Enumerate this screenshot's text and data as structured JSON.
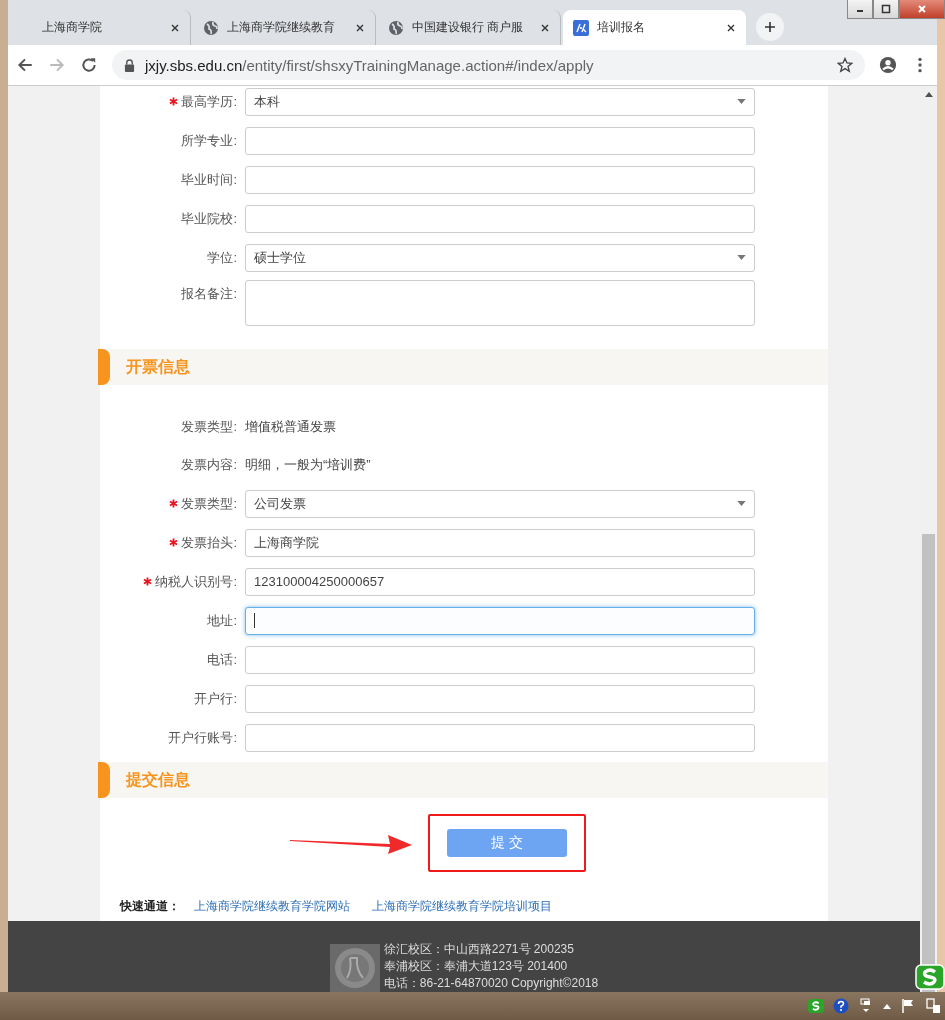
{
  "browser": {
    "tabs": [
      {
        "title": "上海商学院",
        "kind": "blank",
        "selected": false
      },
      {
        "title": "上海商学院继续教育",
        "kind": "web",
        "selected": false
      },
      {
        "title": "中国建设银行 商户服",
        "kind": "web",
        "selected": false
      },
      {
        "title": "培训报名",
        "kind": "site",
        "selected": true
      }
    ],
    "url_host": "jxjy.sbs.edu.cn",
    "url_path": "/entity/first/shsxyTrainingManage.action#/index/apply"
  },
  "education_rows": [
    {
      "kind": "select",
      "label": "最高学历:",
      "required": true,
      "value": "本科"
    },
    {
      "kind": "input",
      "label": "所学专业:",
      "required": false,
      "value": "",
      "focused": false
    },
    {
      "kind": "input",
      "label": "毕业时间:",
      "required": false,
      "value": "",
      "focused": false
    },
    {
      "kind": "input",
      "label": "毕业院校:",
      "required": false,
      "value": "",
      "focused": false
    },
    {
      "kind": "select",
      "label": "学位:",
      "required": false,
      "value": "硕士学位"
    },
    {
      "kind": "textarea",
      "label": "报名备注:",
      "required": false,
      "value": ""
    }
  ],
  "invoice_section": {
    "title": "开票信息"
  },
  "invoice_rows": [
    {
      "kind": "text",
      "label": "发票类型:",
      "value": "增值税普通发票"
    },
    {
      "kind": "text",
      "label": "发票内容:",
      "value": "明细，一般为“培训费”"
    },
    {
      "kind": "select",
      "label": "发票类型:",
      "required": true,
      "value": "公司发票"
    },
    {
      "kind": "input",
      "label": "发票抬头:",
      "required": true,
      "value": "上海商学院",
      "focused": false
    },
    {
      "kind": "input",
      "label": "纳税人识别号:",
      "required": true,
      "value": "123100004250000657",
      "focused": false
    },
    {
      "kind": "input",
      "label": "地址:",
      "required": false,
      "value": "",
      "focused": true
    },
    {
      "kind": "input",
      "label": "电话:",
      "required": false,
      "value": "",
      "focused": false
    },
    {
      "kind": "input",
      "label": "开户行:",
      "required": false,
      "value": "",
      "focused": false
    },
    {
      "kind": "input",
      "label": "开户行账号:",
      "required": false,
      "value": "",
      "focused": false
    }
  ],
  "submit_section": {
    "title": "提交信息",
    "button": "提 交"
  },
  "quick_links": {
    "label": "快速通道：",
    "links": [
      "上海商学院继续教育学院网站",
      "上海商学院继续教育学院培训项目"
    ]
  },
  "footer": {
    "lines": [
      "徐汇校区：中山西路2271号 200235",
      "奉浦校区：奉浦大道123号 201400",
      "电话：86-21-64870020 Copyright©2018"
    ]
  }
}
